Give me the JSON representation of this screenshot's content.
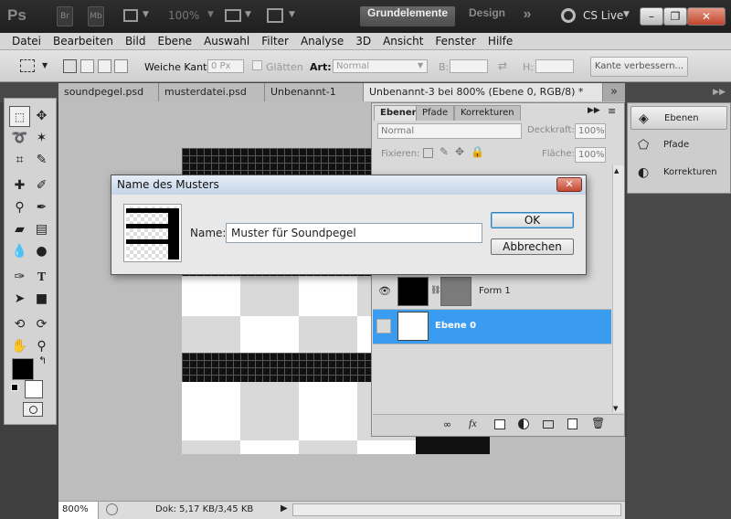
{
  "app": {
    "logo": "Ps",
    "br": "Br",
    "mb": "Mb",
    "zoom": "100%",
    "workspaces": [
      "Grundelemente",
      "Design"
    ],
    "more": "»",
    "cslive": "CS Live"
  },
  "menu": [
    "Datei",
    "Bearbeiten",
    "Bild",
    "Ebene",
    "Auswahl",
    "Filter",
    "Analyse",
    "3D",
    "Ansicht",
    "Fenster",
    "Hilfe"
  ],
  "options": {
    "soft_edge_label": "Weiche Kante:",
    "soft_edge_value": "0 Px",
    "smooth_label": "Glätten",
    "style_label": "Art:",
    "style_value": "Normal",
    "width_label": "B:",
    "height_label": "H:",
    "refine_button": "Kante verbessern..."
  },
  "doc_tabs": [
    "soundpegel.psd",
    "musterdatei.psd",
    "Unbenannt-1",
    "Unbenannt-3 bei 800% (Ebene 0, RGB/8) *"
  ],
  "status": {
    "zoom": "800%",
    "doc": "Dok: 5,17 KB/3,45 KB"
  },
  "layers_panel": {
    "tabs": [
      "Ebenen",
      "Pfade",
      "Korrekturen"
    ],
    "blend_mode": "Normal",
    "opacity_label": "Deckkraft:",
    "opacity_value": "100%",
    "lock_label": "Fixieren:",
    "fill_label": "Fläche:",
    "fill_value": "100%",
    "layers": [
      {
        "name": "Form 1",
        "visible": true,
        "selected": false
      },
      {
        "name": "Ebene 0",
        "visible": false,
        "selected": true
      }
    ],
    "selected_color": "#3a9cf0"
  },
  "dock": [
    {
      "label": "Ebenen",
      "icon": "layers-icon"
    },
    {
      "label": "Pfade",
      "icon": "paths-icon"
    },
    {
      "label": "Korrekturen",
      "icon": "adjustments-icon"
    }
  ],
  "dialog": {
    "title": "Name des Musters",
    "close": "✕",
    "name_label": "Name:",
    "name_value": "Muster für Soundpegel",
    "ok": "OK",
    "cancel": "Abbrechen"
  }
}
